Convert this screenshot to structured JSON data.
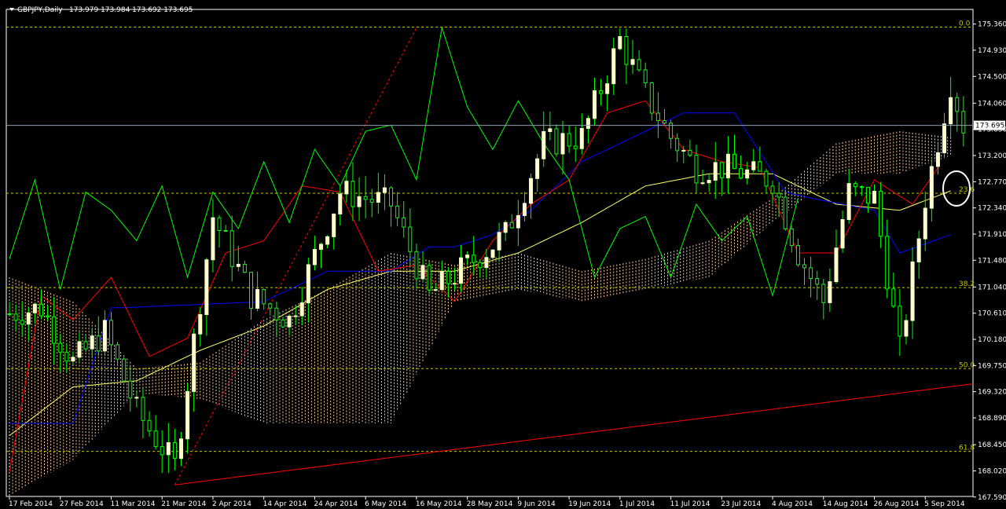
{
  "header": {
    "menu_icon": "triangle-down-icon",
    "symbol": "GBPJPY,Daily",
    "ohlc": "173.979 173.984 173.692 173.695"
  },
  "colors": {
    "background": "#000000",
    "frame": "#ffffff",
    "candle_up": "#ffffcc",
    "candle_down": "#00ff00",
    "wick": "#00ff00",
    "tenkan": "#ff0000",
    "kijun": "#0000ff",
    "chikou": "#00ff00",
    "ma": "#ffff66",
    "cloud": "#ffcc99",
    "fib": "#c8c800",
    "trendline": "#ff0000",
    "current_price_line": "#8fa0b0"
  },
  "chart_data": {
    "type": "candlestick",
    "symbol": "GBPJPY",
    "timeframe": "Daily",
    "ylim": [
      167.6,
      175.6
    ],
    "y_ticks": [
      "175.360",
      "174.930",
      "174.500",
      "174.060",
      "173.630",
      "173.200",
      "172.770",
      "172.340",
      "171.910",
      "171.480",
      "171.040",
      "170.610",
      "170.180",
      "169.750",
      "169.320",
      "168.890",
      "168.450",
      "168.020",
      "167.590"
    ],
    "y_tick_values": [
      175.36,
      174.93,
      174.5,
      174.06,
      173.63,
      173.2,
      172.77,
      172.34,
      171.91,
      171.48,
      171.04,
      170.61,
      170.18,
      169.75,
      169.32,
      168.89,
      168.45,
      168.02,
      167.59
    ],
    "x_ticks": [
      "17 Feb 2014",
      "27 Feb 2014",
      "11 Mar 2014",
      "21 Mar 2014",
      "2 Apr 2014",
      "14 Apr 2014",
      "24 Apr 2014",
      "6 May 2014",
      "16 May 2014",
      "28 May 2014",
      "9 Jun 2014",
      "19 Jun 2014",
      "1 Jul 2014",
      "11 Jul 2014",
      "23 Jul 2014",
      "4 Aug 2014",
      "14 Aug 2014",
      "26 Aug 2014",
      "5 Sep 2014"
    ],
    "x_tick_index": [
      0,
      8,
      16,
      24,
      32,
      40,
      48,
      56,
      64,
      72,
      80,
      88,
      96,
      104,
      112,
      120,
      128,
      136,
      144
    ],
    "current_price": "173.695",
    "current_price_value": 173.695,
    "fibonacci": [
      {
        "label": "0.0",
        "value": 175.31
      },
      {
        "label": "23.6",
        "value": 172.58
      },
      {
        "label": "38.2",
        "value": 171.03
      },
      {
        "label": "50.0",
        "value": 169.7
      },
      {
        "label": "61.8",
        "value": 168.34
      }
    ],
    "trendline": {
      "from_index": 26,
      "from_value": 167.79,
      "to_index": 178,
      "to_value": 169.45
    },
    "trendline_dashed": {
      "from_index": 26,
      "from_value": 167.79,
      "to_index": 64,
      "to_value": 175.3
    },
    "candles_summary": {
      "anchors_index": [
        0,
        5,
        10,
        15,
        20,
        26,
        32,
        38,
        44,
        52,
        60,
        66,
        72,
        78,
        84,
        90,
        96,
        100,
        104,
        108,
        112,
        116,
        120,
        124,
        128,
        132,
        136,
        140,
        144,
        148,
        150
      ],
      "anchors_close": [
        170.6,
        170.7,
        169.8,
        170.3,
        169.0,
        168.1,
        172.2,
        170.9,
        170.5,
        172.6,
        172.4,
        170.9,
        171.4,
        171.9,
        173.4,
        173.5,
        175.1,
        174.2,
        173.5,
        173.0,
        173.0,
        172.9,
        172.8,
        171.6,
        170.8,
        172.6,
        172.5,
        170.0,
        172.5,
        174.4,
        173.7
      ]
    },
    "tenkan_anchors": {
      "index": [
        0,
        5,
        10,
        16,
        22,
        28,
        34,
        40,
        46,
        52,
        58,
        64,
        70,
        76,
        82,
        88,
        94,
        100,
        106,
        112,
        118,
        124,
        130,
        136,
        142,
        146
      ],
      "value": [
        168.0,
        170.9,
        170.5,
        171.2,
        169.9,
        170.2,
        171.6,
        171.8,
        172.7,
        172.6,
        171.3,
        171.4,
        170.8,
        171.8,
        172.4,
        172.8,
        173.9,
        174.1,
        173.3,
        173.1,
        173.0,
        171.6,
        171.6,
        172.8,
        172.4,
        173.0
      ]
    },
    "kijun_anchors": {
      "index": [
        0,
        10,
        16,
        18,
        40,
        50,
        60,
        66,
        70,
        76,
        82,
        90,
        100,
        106,
        114,
        122,
        126,
        136,
        140,
        148
      ],
      "value": [
        168.8,
        168.8,
        170.7,
        170.7,
        170.8,
        171.3,
        171.3,
        171.7,
        171.7,
        171.9,
        172.3,
        173.1,
        173.6,
        173.9,
        173.9,
        172.6,
        172.5,
        172.3,
        171.6,
        171.9
      ]
    },
    "ma_anchors": {
      "index": [
        0,
        10,
        20,
        30,
        40,
        50,
        60,
        70,
        80,
        90,
        100,
        110,
        120,
        130,
        140,
        150
      ],
      "value": [
        168.6,
        169.4,
        169.5,
        170.0,
        170.4,
        171.0,
        171.3,
        171.3,
        171.6,
        172.1,
        172.7,
        172.9,
        172.9,
        172.4,
        172.3,
        172.7
      ]
    },
    "chikou_anchors": {
      "index": [
        0,
        4,
        8,
        12,
        16,
        20,
        24,
        28,
        32,
        36,
        40,
        44,
        48,
        52,
        56,
        60,
        64,
        68,
        72,
        76,
        80,
        84,
        88,
        92,
        96,
        100,
        104,
        108,
        112,
        116,
        120,
        124
      ],
      "value": [
        171.5,
        172.8,
        171.0,
        172.6,
        172.3,
        171.8,
        172.7,
        171.2,
        172.6,
        172.0,
        173.1,
        172.1,
        173.3,
        172.7,
        173.6,
        173.7,
        172.8,
        175.3,
        174.0,
        173.3,
        174.1,
        173.4,
        172.8,
        171.2,
        172.0,
        172.2,
        171.2,
        172.4,
        171.8,
        172.2,
        170.9,
        172.5
      ]
    },
    "cloud_anchors": {
      "index": [
        0,
        10,
        20,
        30,
        40,
        50,
        60,
        70,
        80,
        90,
        100,
        110,
        120,
        130,
        140,
        148
      ],
      "top": [
        171.2,
        170.8,
        169.7,
        169.8,
        170.5,
        171.0,
        171.6,
        171.4,
        171.6,
        171.3,
        171.5,
        171.8,
        172.5,
        173.4,
        173.6,
        173.5
      ],
      "bottom": [
        167.6,
        168.2,
        169.3,
        169.2,
        168.8,
        168.8,
        168.8,
        170.8,
        171.0,
        170.8,
        171.0,
        171.2,
        172.1,
        172.9,
        172.9,
        173.2
      ]
    }
  }
}
